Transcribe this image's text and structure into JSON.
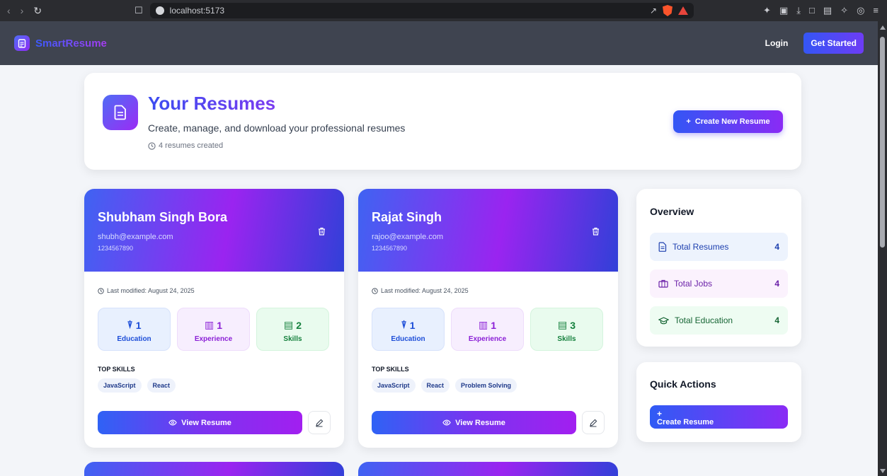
{
  "browser": {
    "url": "localhost:5173"
  },
  "nav": {
    "logo_text": "SmartResume",
    "login": "Login",
    "get_started": "Get Started"
  },
  "header": {
    "title": "Your Resumes",
    "subtitle": "Create, manage, and download your professional resumes",
    "count_text": "4 resumes created",
    "create_button": "Create New Resume"
  },
  "resumes": [
    {
      "name": "Shubham Singh Bora",
      "email": "shubh@example.com",
      "phone": "1234567890",
      "modified": "Last modified: August 24, 2025",
      "education": "1",
      "experience": "1",
      "skills": "2",
      "skills_list": [
        "JavaScript",
        "React"
      ]
    },
    {
      "name": "Rajat Singh",
      "email": "rajoo@example.com",
      "phone": "1234567890",
      "modified": "Last modified: August 24, 2025",
      "education": "1",
      "experience": "1",
      "skills": "3",
      "skills_list": [
        "JavaScript",
        "React",
        "Problem Solving"
      ]
    }
  ],
  "labels": {
    "education": "Education",
    "experience": "Experience",
    "skills": "Skills",
    "top_skills": "TOP SKILLS",
    "view_resume": "View Resume"
  },
  "overview": {
    "title": "Overview",
    "rows": [
      {
        "label": "Total Resumes",
        "value": "4"
      },
      {
        "label": "Total Jobs",
        "value": "4"
      },
      {
        "label": "Total Education",
        "value": "4"
      }
    ]
  },
  "quick_actions": {
    "title": "Quick Actions",
    "plus": "+",
    "create_resume": "Create Resume"
  },
  "icons": {
    "document": "document-icon",
    "clock": "clock-icon",
    "trash": "trash-icon",
    "grad_cap": "graduation-cap-icon",
    "briefcase": "briefcase-icon",
    "eye": "eye-icon",
    "pencil": "pencil-icon"
  }
}
